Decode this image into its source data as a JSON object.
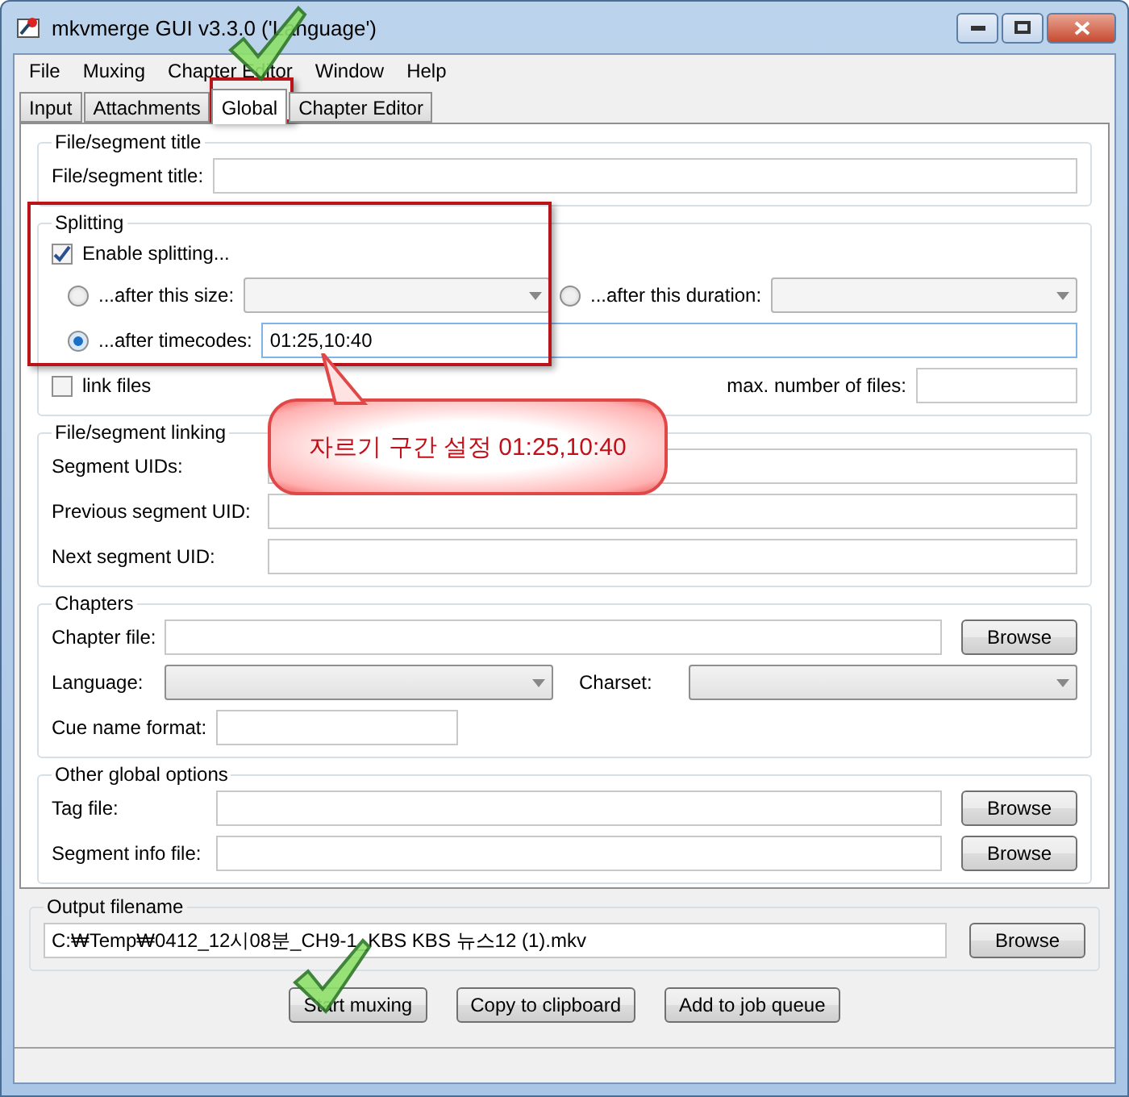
{
  "window": {
    "title": "mkvmerge GUI v3.3.0 ('Language')"
  },
  "menu": [
    "File",
    "Muxing",
    "Chapter Editor",
    "Window",
    "Help"
  ],
  "tabs": [
    {
      "label": "Input",
      "selected": false
    },
    {
      "label": "Attachments",
      "selected": false
    },
    {
      "label": "Global",
      "selected": true
    },
    {
      "label": "Chapter Editor",
      "selected": false
    }
  ],
  "title_group": {
    "heading": "File/segment title",
    "label": "File/segment title:"
  },
  "splitting": {
    "heading": "Splitting",
    "enable": {
      "label": "Enable splitting...",
      "checked": true
    },
    "options": [
      {
        "label": "...after this size:",
        "selected": false,
        "kind": "dropdown"
      },
      {
        "label": "...after this duration:",
        "selected": false,
        "kind": "dropdown"
      },
      {
        "label": "...after timecodes:",
        "selected": true,
        "kind": "text",
        "value": "01:25,10:40"
      }
    ],
    "link_files": {
      "label": "link files",
      "checked": false
    },
    "max_files_label": "max. number of files:"
  },
  "linking": {
    "heading": "File/segment linking",
    "fields": [
      "Segment UIDs:",
      "Previous segment UID:",
      "Next segment UID:"
    ]
  },
  "chapters": {
    "heading": "Chapters",
    "file_label": "Chapter file:",
    "browse": "Browse",
    "language_label": "Language:",
    "charset_label": "Charset:",
    "cue_label": "Cue name format:"
  },
  "other": {
    "heading": "Other global options",
    "rows": [
      {
        "label": "Tag file:",
        "button": "Browse"
      },
      {
        "label": "Segment info file:",
        "button": "Browse"
      }
    ]
  },
  "output": {
    "heading": "Output filename",
    "value": "C:₩Temp₩0412_12시08분_CH9-1_KBS KBS 뉴스12 (1).mkv",
    "button": "Browse"
  },
  "actions": [
    "Start muxing",
    "Copy to clipboard",
    "Add to job queue"
  ],
  "callout": {
    "text": "자르기 구간 설정 01:25,10:40"
  }
}
